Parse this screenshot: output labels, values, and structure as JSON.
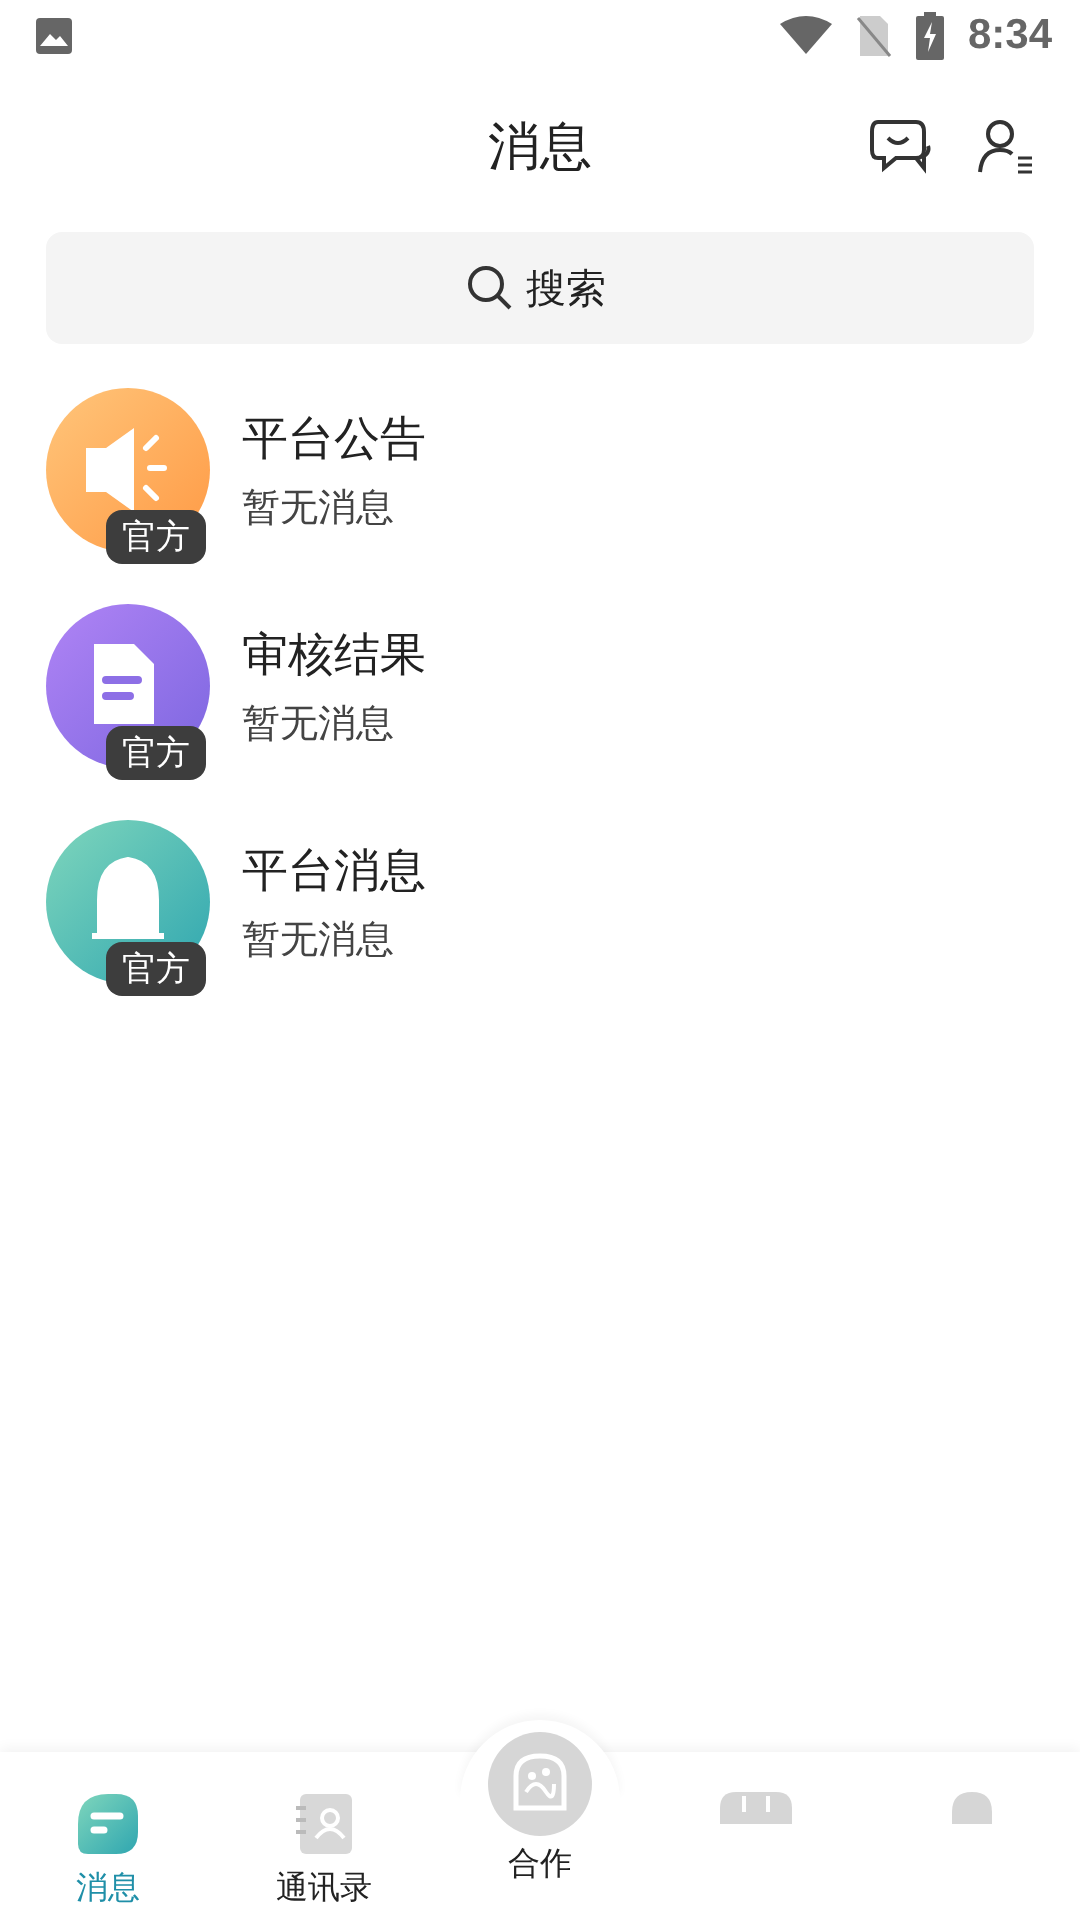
{
  "status_bar": {
    "time": "8:34"
  },
  "header": {
    "title": "消息"
  },
  "search": {
    "placeholder": "搜索"
  },
  "conversations": [
    {
      "kind": "announce",
      "title": "平台公告",
      "preview": "暂无消息",
      "badge": "官方"
    },
    {
      "kind": "review",
      "title": "审核结果",
      "preview": "暂无消息",
      "badge": "官方"
    },
    {
      "kind": "notice",
      "title": "平台消息",
      "preview": "暂无消息",
      "badge": "官方"
    }
  ],
  "tab_bar": [
    {
      "kind": "messages",
      "label": "消息",
      "selected": true
    },
    {
      "kind": "contacts",
      "label": "通讯录",
      "selected": false
    },
    {
      "kind": "cooperate",
      "label": "合作",
      "selected": false
    },
    {
      "kind": "calendar",
      "selected": false
    },
    {
      "kind": "profile",
      "selected": false
    }
  ]
}
